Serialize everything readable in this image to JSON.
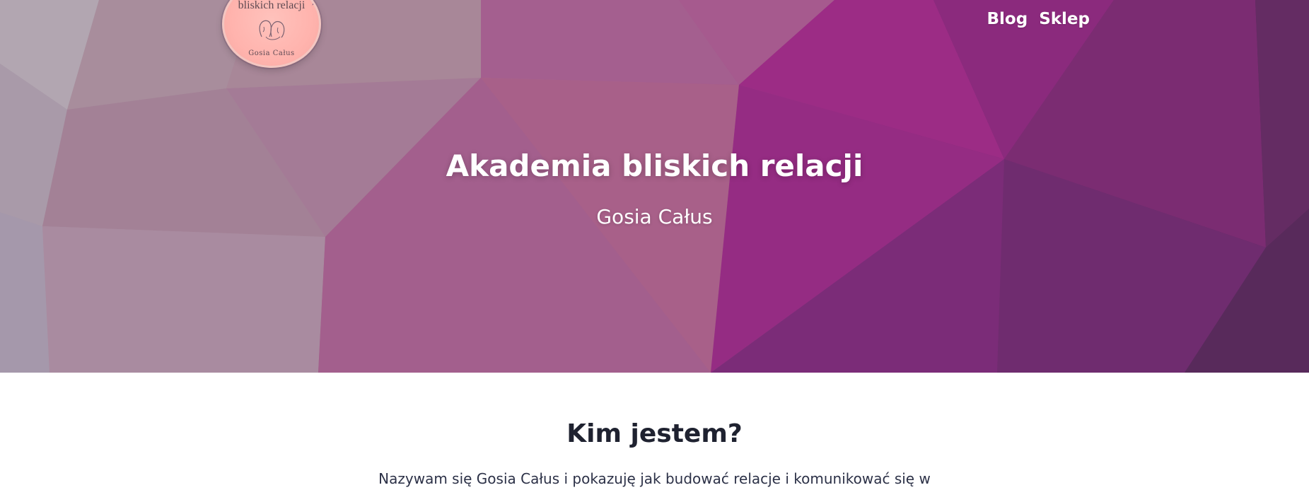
{
  "logo": {
    "text_line": "bliskich relacji",
    "signature": "Gosia Całus"
  },
  "nav": {
    "items": [
      {
        "label": "Blog"
      },
      {
        "label": "Sklep"
      }
    ]
  },
  "hero": {
    "title": "Akademia bliskich relacji",
    "subtitle": "Gosia Całus"
  },
  "about": {
    "title": "Kim jestem?",
    "text": "Nazywam się Gosia Całus i pokazuję jak budować relacje i komunikować się w"
  },
  "colors": {
    "hero_left": "#a79aa7",
    "hero_center": "#b15f8f",
    "hero_right": "#5a2a5f",
    "heading_dark": "#1f2230",
    "body_text": "#2c3147",
    "white": "#ffffff"
  }
}
